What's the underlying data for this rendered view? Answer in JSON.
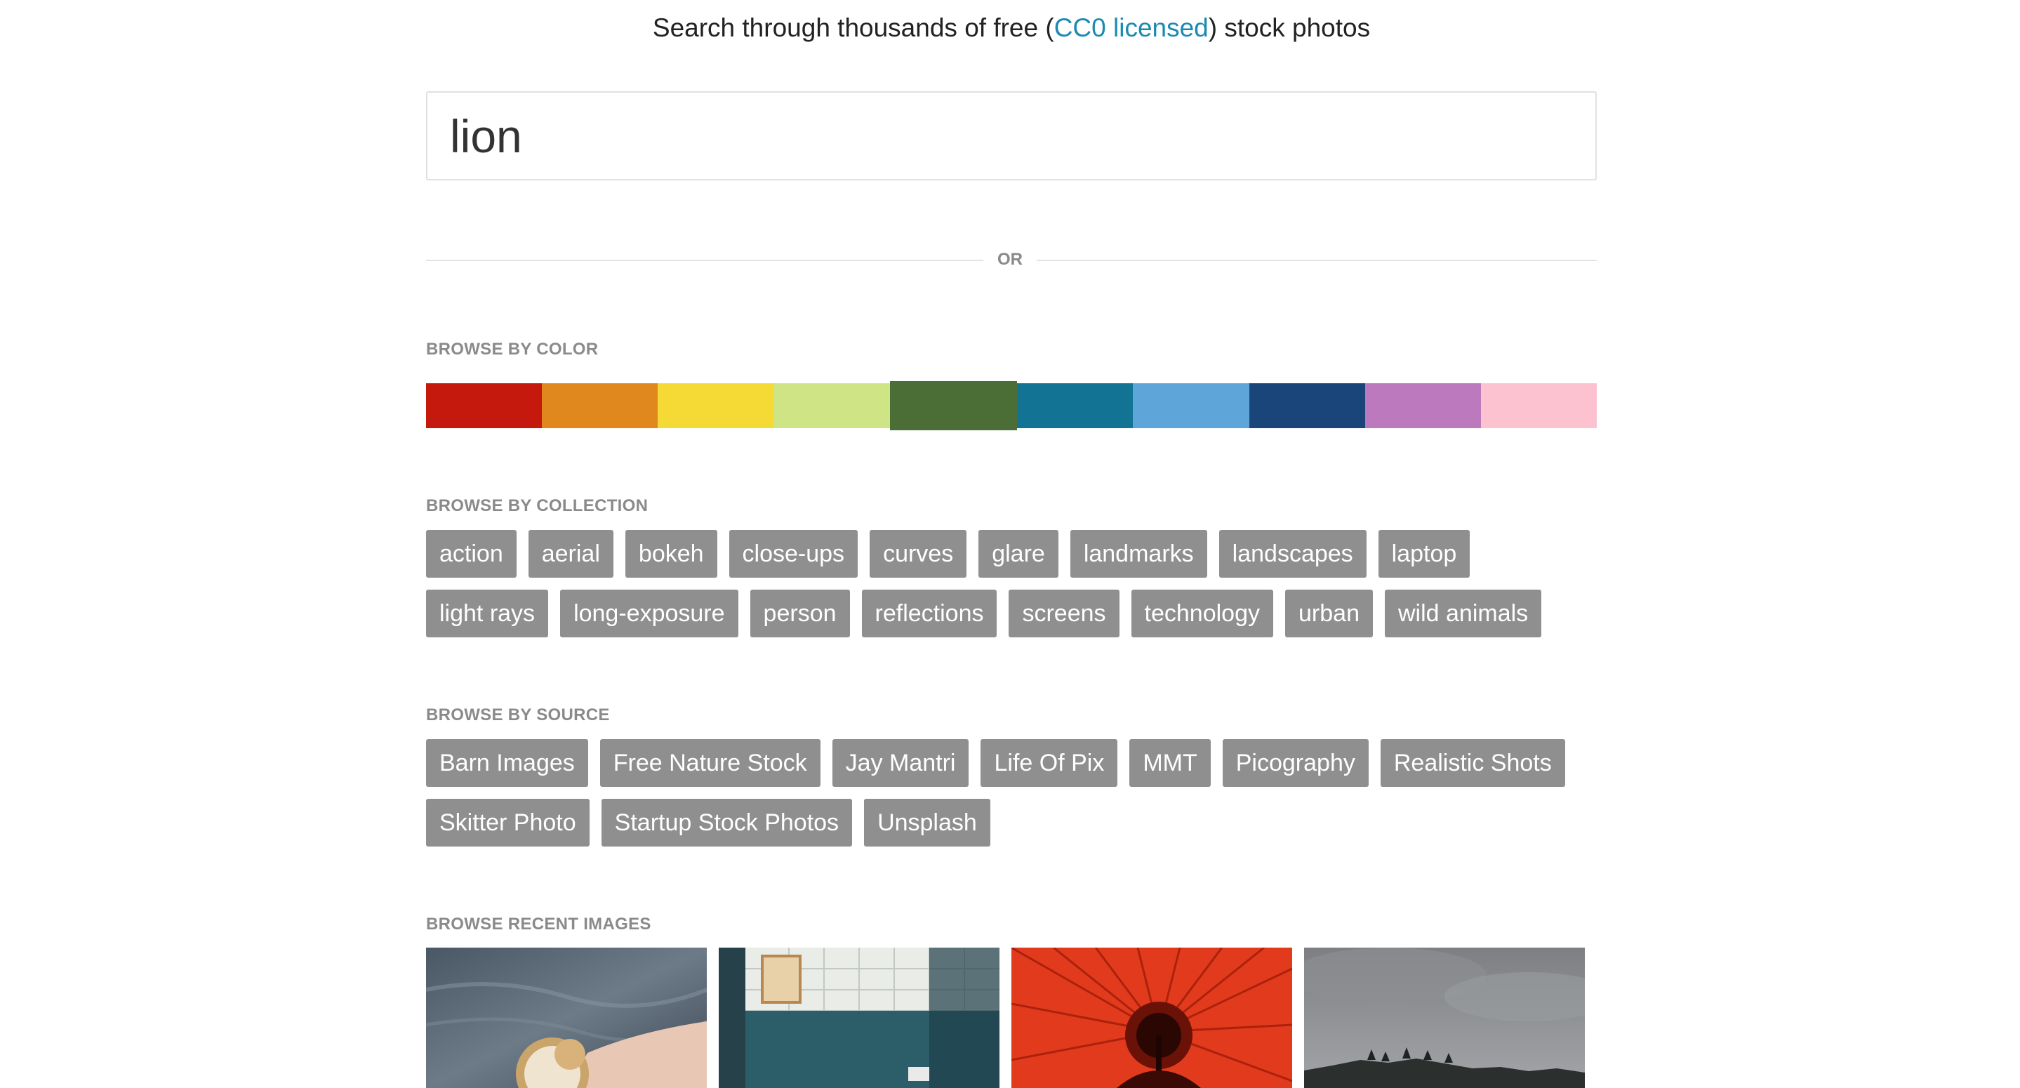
{
  "tagline": {
    "before": "Search through thousands of free (",
    "link": "CC0 licensed",
    "after": ") stock photos"
  },
  "search": {
    "value": "lion",
    "placeholder": ""
  },
  "divider": {
    "label": "OR"
  },
  "color_section": {
    "title": "BROWSE BY COLOR",
    "selected": "green",
    "colors": [
      {
        "name": "red",
        "hex": "#c4190c"
      },
      {
        "name": "orange",
        "hex": "#e0871e"
      },
      {
        "name": "yellow",
        "hex": "#f5da36"
      },
      {
        "name": "lime",
        "hex": "#cfe585"
      },
      {
        "name": "green",
        "hex": "#4b6e37"
      },
      {
        "name": "teal",
        "hex": "#127395"
      },
      {
        "name": "light-blue",
        "hex": "#5ea6d9"
      },
      {
        "name": "navy",
        "hex": "#19457b"
      },
      {
        "name": "purple",
        "hex": "#bc79be"
      },
      {
        "name": "pink",
        "hex": "#fdc2d0"
      }
    ]
  },
  "collection_section": {
    "title": "BROWSE BY COLLECTION",
    "tags": [
      "action",
      "aerial",
      "bokeh",
      "close-ups",
      "curves",
      "glare",
      "landmarks",
      "landscapes",
      "laptop",
      "light rays",
      "long-exposure",
      "person",
      "reflections",
      "screens",
      "technology",
      "urban",
      "wild animals"
    ]
  },
  "source_section": {
    "title": "BROWSE BY SOURCE",
    "tags": [
      "Barn Images",
      "Free Nature Stock",
      "Jay Mantri",
      "Life Of Pix",
      "MMT",
      "Picography",
      "Realistic Shots",
      "Skitter Photo",
      "Startup Stock Photos",
      "Unsplash"
    ]
  },
  "recent_section": {
    "title": "BROWSE RECENT IMAGES",
    "images": [
      {
        "subject": "hand-holding-compass"
      },
      {
        "subject": "abandoned-tiled-room"
      },
      {
        "subject": "red-umbrella-canopy"
      },
      {
        "subject": "misty-hills-forest"
      }
    ]
  }
}
